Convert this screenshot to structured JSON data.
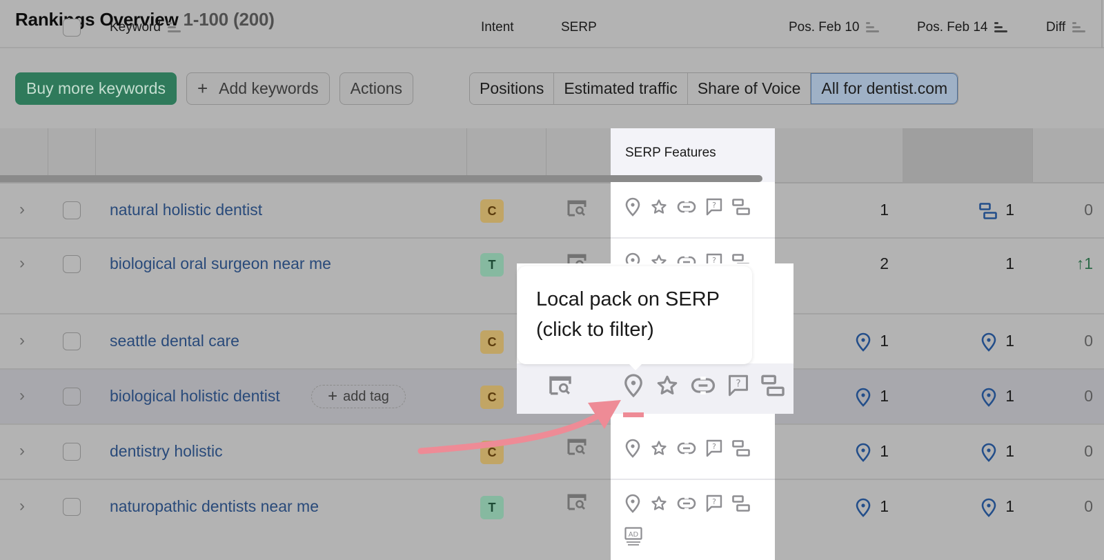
{
  "header": {
    "title": "Rankings Overview",
    "range": "1-100 (200)"
  },
  "toolbar": {
    "buy_label": "Buy more keywords",
    "add_label": "Add keywords",
    "add_icon": "plus-icon",
    "actions_label": "Actions",
    "segments": [
      {
        "label": "Positions",
        "active": false
      },
      {
        "label": "Estimated traffic",
        "active": false
      },
      {
        "label": "Share of Voice",
        "active": false
      },
      {
        "label": "All for dentist.com",
        "active": true
      }
    ]
  },
  "table": {
    "columns": {
      "keyword": "Keyword",
      "intent": "Intent",
      "serp": "SERP",
      "serp_features": "SERP Features",
      "pos_feb10": "Pos. Feb 10",
      "pos_feb14": "Pos. Feb 14",
      "diff": "Diff"
    },
    "rows": [
      {
        "keyword": "natural holistic dentist",
        "intent": "C",
        "features": [
          "local-pack",
          "reviews",
          "sitelinks",
          "people-also-ask",
          "top-stories"
        ],
        "pos_feb10": "1",
        "pos_feb10_icon": "",
        "pos_feb14": "1",
        "pos_feb14_icon": "top-stories-icon",
        "diff": "0",
        "diff_direction": "none"
      },
      {
        "keyword": "biological oral surgeon near me",
        "intent": "T",
        "features": [
          "local-pack",
          "reviews",
          "sitelinks",
          "people-also-ask",
          "top-stories"
        ],
        "pos_feb10": "2",
        "pos_feb10_icon": "",
        "pos_feb14": "1",
        "pos_feb14_icon": "",
        "diff": "1",
        "diff_direction": "up"
      },
      {
        "keyword": "seattle dental care",
        "intent": "C",
        "features": [],
        "pos_feb10": "1",
        "pos_feb10_icon": "local-pack-icon",
        "pos_feb14": "1",
        "pos_feb14_icon": "local-pack-icon",
        "diff": "0",
        "diff_direction": "none"
      },
      {
        "keyword": "biological holistic dentist",
        "intent": "C",
        "add_tag": "add tag",
        "features": [
          "local-pack",
          "reviews",
          "sitelinks",
          "people-also-ask",
          "top-stories"
        ],
        "pos_feb10": "1",
        "pos_feb10_icon": "local-pack-icon",
        "pos_feb14": "1",
        "pos_feb14_icon": "local-pack-icon",
        "diff": "0",
        "diff_direction": "none"
      },
      {
        "keyword": "dentistry holistic",
        "intent": "C",
        "features": [
          "local-pack",
          "reviews",
          "sitelinks",
          "people-also-ask",
          "top-stories"
        ],
        "pos_feb10": "1",
        "pos_feb10_icon": "local-pack-icon",
        "pos_feb14": "1",
        "pos_feb14_icon": "local-pack-icon",
        "diff": "0",
        "diff_direction": "none"
      },
      {
        "keyword": "naturopathic dentists near me",
        "intent": "T",
        "features": [
          "local-pack",
          "reviews",
          "sitelinks",
          "people-also-ask",
          "top-stories",
          "ads-top"
        ],
        "pos_feb10": "1",
        "pos_feb10_icon": "local-pack-icon",
        "pos_feb14": "1",
        "pos_feb14_icon": "local-pack-icon",
        "diff": "0",
        "diff_direction": "none"
      }
    ]
  },
  "tooltip": {
    "line1": "Local pack on SERP",
    "line2": "(click to filter)"
  },
  "colors": {
    "primary_green": "#2f7a5b",
    "link_blue": "#294a7a",
    "intent_commercial": "#c1a565",
    "intent_transactional": "#86b9a0",
    "annotation_pink": "#ee8b96",
    "diff_up": "#2d6a48"
  }
}
